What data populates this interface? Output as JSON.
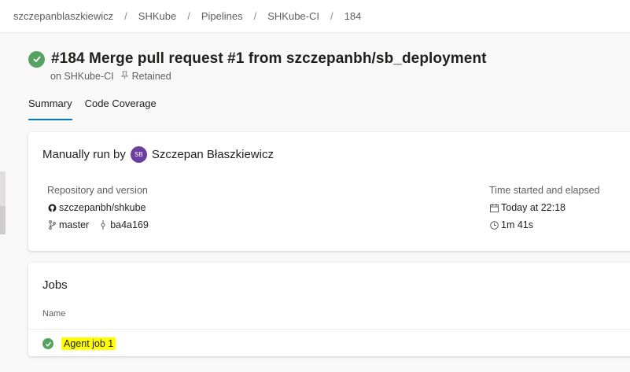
{
  "breadcrumb": [
    "szczepanblaszkiewicz",
    "SHKube",
    "Pipelines",
    "SHKube-CI",
    "184"
  ],
  "run": {
    "title": "#184 Merge pull request #1 from szczepanbh/sb_deployment",
    "pipeline": "on SHKube-CI",
    "retained": "Retained"
  },
  "tabs": [
    "Summary",
    "Code Coverage"
  ],
  "summary": {
    "manually_run_by": "Manually run by",
    "avatar_initials": "SB",
    "user": "Szczepan Błaszkiewicz",
    "repo_label": "Repository and version",
    "repo": "szczepanbh/shkube",
    "branch": "master",
    "commit": "ba4a169",
    "time_label": "Time started and elapsed",
    "started": "Today at 22:18",
    "elapsed": "1m 41s"
  },
  "jobs": {
    "title": "Jobs",
    "name_header": "Name",
    "items": [
      {
        "name": "Agent job 1",
        "status": "succeeded"
      }
    ]
  },
  "colors": {
    "success": "#55a362",
    "accent": "#0078d4",
    "avatar": "#6b3fa0",
    "highlight": "#ffff00"
  }
}
